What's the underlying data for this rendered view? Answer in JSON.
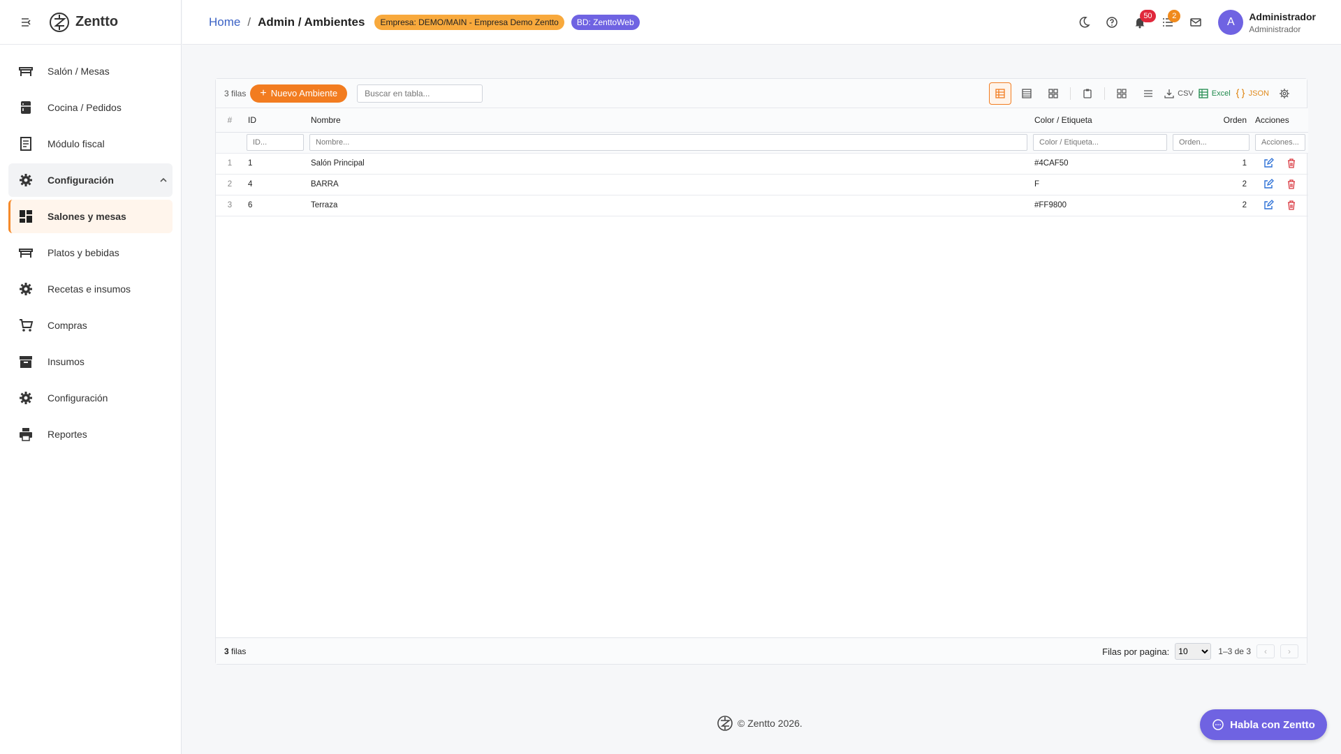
{
  "brand": {
    "name": "Zentto"
  },
  "sidebar": {
    "items": [
      {
        "label": "Salón / Mesas",
        "icon": "table-icon"
      },
      {
        "label": "Cocina / Pedidos",
        "icon": "kitchen-icon"
      },
      {
        "label": "Módulo fiscal",
        "icon": "receipt-icon"
      },
      {
        "label": "Configuración",
        "icon": "gear-icon"
      },
      {
        "label": "Salones y mesas",
        "icon": "dashboard-icon"
      },
      {
        "label": "Platos y bebidas",
        "icon": "table-icon"
      },
      {
        "label": "Recetas e insumos",
        "icon": "gear-icon"
      },
      {
        "label": "Compras",
        "icon": "cart-icon"
      },
      {
        "label": "Insumos",
        "icon": "archive-icon"
      },
      {
        "label": "Configuración",
        "icon": "gear-icon"
      },
      {
        "label": "Reportes",
        "icon": "printer-icon"
      }
    ]
  },
  "header": {
    "breadcrumb_home": "Home",
    "breadcrumb_sep": "/",
    "breadcrumb_current": "Admin / Ambientes",
    "empresa_pill": "Empresa: DEMO/MAIN - Empresa Demo Zentto",
    "bd_pill": "BD: ZenttoWeb",
    "notifications_count": "50",
    "tasks_count": "2",
    "avatar_letter": "A",
    "user_name": "Administrador",
    "user_role": "Administrador"
  },
  "toolbar": {
    "row_count": "3 filas",
    "new_button": "Nuevo Ambiente",
    "search_placeholder": "Buscar en tabla...",
    "csv_label": "CSV",
    "excel_label": "Excel",
    "json_label": "JSON"
  },
  "table": {
    "headers": {
      "num": "#",
      "id": "ID",
      "nombre": "Nombre",
      "color": "Color / Etiqueta",
      "orden": "Orden",
      "acciones": "Acciones"
    },
    "filters": {
      "id": "ID...",
      "nombre": "Nombre...",
      "color": "Color / Etiqueta...",
      "orden": "Orden...",
      "acciones": "Acciones..."
    },
    "rows": [
      {
        "num": "1",
        "id": "1",
        "nombre": "Salón Principal",
        "color": "#4CAF50",
        "orden": "1"
      },
      {
        "num": "2",
        "id": "4",
        "nombre": "BARRA",
        "color": "F",
        "orden": "2"
      },
      {
        "num": "3",
        "id": "6",
        "nombre": "Terraza",
        "color": "#FF9800",
        "orden": "2"
      }
    ]
  },
  "footer": {
    "count_number": "3",
    "count_label": "filas",
    "rows_per_page_label": "Filas por pagina:",
    "rows_per_page": "10",
    "range": "1–3 de 3",
    "prev": "‹",
    "next": "›"
  },
  "copyright": "© Zentto 2026.",
  "chat_button": "Habla con Zentto",
  "colors": {
    "accent": "#f27c20",
    "purple": "#6f63e2",
    "link": "#3b62c5",
    "edit": "#2a6fd6",
    "delete": "#d9363e"
  }
}
